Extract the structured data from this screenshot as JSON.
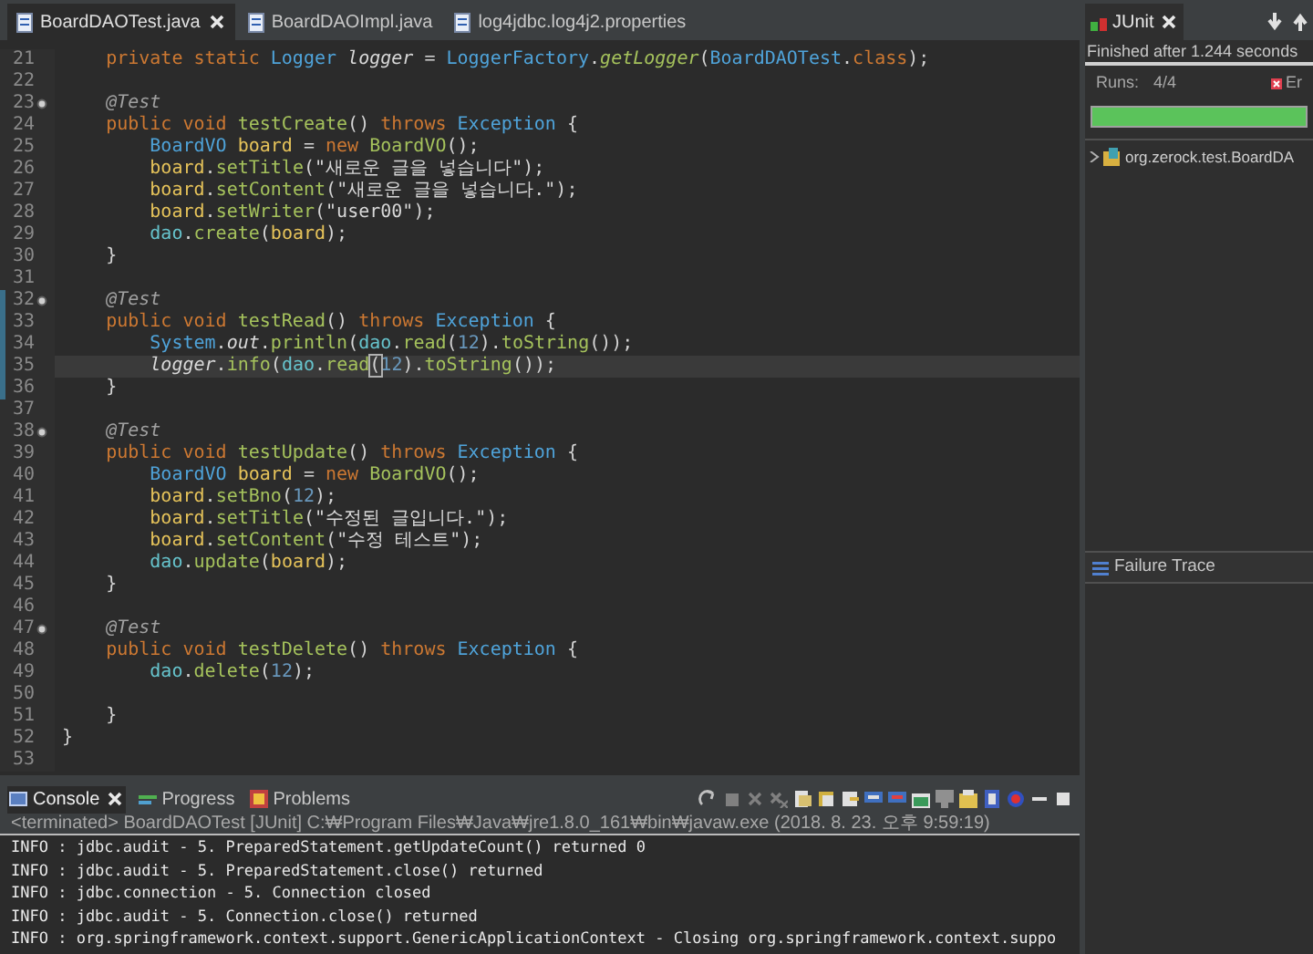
{
  "editor": {
    "tabs": [
      {
        "label": "BoardDAOTest.java",
        "selected": true,
        "closable": true
      },
      {
        "label": "BoardDAOImpl.java",
        "selected": false,
        "closable": false
      },
      {
        "label": "log4jdbc.log4j2.properties",
        "selected": false,
        "closable": false
      }
    ],
    "lines": [
      {
        "number": "21",
        "fold": false,
        "changed": false,
        "current": false,
        "tokens": [
          {
            "kind": "keyword",
            "text": "    private static "
          },
          {
            "kind": "type",
            "text": "Logger "
          },
          {
            "kind": "static",
            "text": "logger"
          },
          {
            "kind": "plain",
            "text": " = "
          },
          {
            "kind": "type",
            "text": "LoggerFactory"
          },
          {
            "kind": "plain",
            "text": "."
          },
          {
            "kind": "static-method",
            "text": "getLogger"
          },
          {
            "kind": "plain",
            "text": "("
          },
          {
            "kind": "type",
            "text": "BoardDAOTest"
          },
          {
            "kind": "plain",
            "text": "."
          },
          {
            "kind": "keyword",
            "text": "class"
          },
          {
            "kind": "plain",
            "text": ");"
          }
        ]
      },
      {
        "number": "22",
        "fold": false,
        "changed": false,
        "current": false
      },
      {
        "number": "23",
        "fold": true,
        "changed": false,
        "current": false,
        "tokens": [
          {
            "kind": "annotation",
            "text": "    @Test"
          }
        ]
      },
      {
        "number": "24",
        "fold": false,
        "changed": false,
        "current": false,
        "tokens": [
          {
            "kind": "keyword",
            "text": "    public void "
          },
          {
            "kind": "method",
            "text": "testCreate"
          },
          {
            "kind": "plain",
            "text": "() "
          },
          {
            "kind": "keyword",
            "text": "throws "
          },
          {
            "kind": "type",
            "text": "Exception"
          },
          {
            "kind": "plain",
            "text": " {"
          }
        ]
      },
      {
        "number": "25",
        "fold": false,
        "changed": false,
        "current": false,
        "tokens": [
          {
            "kind": "type",
            "text": "        BoardVO "
          },
          {
            "kind": "local",
            "text": "board"
          },
          {
            "kind": "plain",
            "text": " = "
          },
          {
            "kind": "keyword",
            "text": "new "
          },
          {
            "kind": "method",
            "text": "BoardVO"
          },
          {
            "kind": "plain",
            "text": "();"
          }
        ]
      },
      {
        "number": "26",
        "fold": false,
        "changed": false,
        "current": false,
        "tokens": [
          {
            "kind": "local",
            "text": "        board"
          },
          {
            "kind": "plain",
            "text": "."
          },
          {
            "kind": "method",
            "text": "setTitle"
          },
          {
            "kind": "plain",
            "text": "("
          },
          {
            "kind": "string",
            "text": "\"새로운 글을 넣습니다\""
          },
          {
            "kind": "plain",
            "text": ");"
          }
        ]
      },
      {
        "number": "27",
        "fold": false,
        "changed": false,
        "current": false,
        "tokens": [
          {
            "kind": "local",
            "text": "        board"
          },
          {
            "kind": "plain",
            "text": "."
          },
          {
            "kind": "method",
            "text": "setContent"
          },
          {
            "kind": "plain",
            "text": "("
          },
          {
            "kind": "string",
            "text": "\"새로운 글을 넣습니다.\""
          },
          {
            "kind": "plain",
            "text": ");"
          }
        ]
      },
      {
        "number": "28",
        "fold": false,
        "changed": false,
        "current": false,
        "tokens": [
          {
            "kind": "local",
            "text": "        board"
          },
          {
            "kind": "plain",
            "text": "."
          },
          {
            "kind": "method",
            "text": "setWriter"
          },
          {
            "kind": "plain",
            "text": "("
          },
          {
            "kind": "string",
            "text": "\"user00\""
          },
          {
            "kind": "plain",
            "text": ");"
          }
        ]
      },
      {
        "number": "29",
        "fold": false,
        "changed": false,
        "current": false,
        "tokens": [
          {
            "kind": "field",
            "text": "        dao"
          },
          {
            "kind": "plain",
            "text": "."
          },
          {
            "kind": "method",
            "text": "create"
          },
          {
            "kind": "plain",
            "text": "("
          },
          {
            "kind": "local",
            "text": "board"
          },
          {
            "kind": "plain",
            "text": ");"
          }
        ]
      },
      {
        "number": "30",
        "fold": false,
        "changed": false,
        "current": false,
        "tokens": [
          {
            "kind": "plain",
            "text": "    }"
          }
        ]
      },
      {
        "number": "31",
        "fold": false,
        "changed": false,
        "current": false
      },
      {
        "number": "32",
        "fold": true,
        "changed": true,
        "current": false,
        "tokens": [
          {
            "kind": "annotation",
            "text": "    @Test"
          }
        ]
      },
      {
        "number": "33",
        "fold": false,
        "changed": true,
        "current": false,
        "tokens": [
          {
            "kind": "keyword",
            "text": "    public void "
          },
          {
            "kind": "method",
            "text": "testRead"
          },
          {
            "kind": "plain",
            "text": "() "
          },
          {
            "kind": "keyword",
            "text": "throws "
          },
          {
            "kind": "type",
            "text": "Exception"
          },
          {
            "kind": "plain",
            "text": " {"
          }
        ]
      },
      {
        "number": "34",
        "fold": false,
        "changed": true,
        "current": false,
        "tokens": [
          {
            "kind": "type",
            "text": "        System"
          },
          {
            "kind": "plain",
            "text": "."
          },
          {
            "kind": "static",
            "text": "out"
          },
          {
            "kind": "plain",
            "text": "."
          },
          {
            "kind": "method",
            "text": "println"
          },
          {
            "kind": "plain",
            "text": "("
          },
          {
            "kind": "field",
            "text": "dao"
          },
          {
            "kind": "plain",
            "text": "."
          },
          {
            "kind": "method",
            "text": "read"
          },
          {
            "kind": "plain",
            "text": "("
          },
          {
            "kind": "number",
            "text": "12"
          },
          {
            "kind": "plain",
            "text": ")."
          },
          {
            "kind": "method",
            "text": "toString"
          },
          {
            "kind": "plain",
            "text": "());"
          }
        ]
      },
      {
        "number": "35",
        "fold": false,
        "changed": true,
        "current": true,
        "tokens": [
          {
            "kind": "static",
            "text": "        logger"
          },
          {
            "kind": "plain",
            "text": "."
          },
          {
            "kind": "method",
            "text": "info"
          },
          {
            "kind": "plain",
            "text": "("
          },
          {
            "kind": "field",
            "text": "dao"
          },
          {
            "kind": "plain",
            "text": "."
          },
          {
            "kind": "method",
            "text": "read"
          },
          {
            "kind": "matched",
            "text": "("
          },
          {
            "kind": "number",
            "text": "12"
          },
          {
            "kind": "plain",
            "text": ")."
          },
          {
            "kind": "method",
            "text": "toString"
          },
          {
            "kind": "plain",
            "text": "());"
          }
        ]
      },
      {
        "number": "36",
        "fold": false,
        "changed": true,
        "current": false,
        "tokens": [
          {
            "kind": "plain",
            "text": "    }"
          }
        ]
      },
      {
        "number": "37",
        "fold": false,
        "changed": false,
        "current": false
      },
      {
        "number": "38",
        "fold": true,
        "changed": false,
        "current": false,
        "tokens": [
          {
            "kind": "annotation",
            "text": "    @Test"
          }
        ]
      },
      {
        "number": "39",
        "fold": false,
        "changed": false,
        "current": false,
        "tokens": [
          {
            "kind": "keyword",
            "text": "    public void "
          },
          {
            "kind": "method",
            "text": "testUpdate"
          },
          {
            "kind": "plain",
            "text": "() "
          },
          {
            "kind": "keyword",
            "text": "throws "
          },
          {
            "kind": "type",
            "text": "Exception"
          },
          {
            "kind": "plain",
            "text": " {"
          }
        ]
      },
      {
        "number": "40",
        "fold": false,
        "changed": false,
        "current": false,
        "tokens": [
          {
            "kind": "type",
            "text": "        BoardVO "
          },
          {
            "kind": "local",
            "text": "board"
          },
          {
            "kind": "plain",
            "text": " = "
          },
          {
            "kind": "keyword",
            "text": "new "
          },
          {
            "kind": "method",
            "text": "BoardVO"
          },
          {
            "kind": "plain",
            "text": "();"
          }
        ]
      },
      {
        "number": "41",
        "fold": false,
        "changed": false,
        "current": false,
        "tokens": [
          {
            "kind": "local",
            "text": "        board"
          },
          {
            "kind": "plain",
            "text": "."
          },
          {
            "kind": "method",
            "text": "setBno"
          },
          {
            "kind": "plain",
            "text": "("
          },
          {
            "kind": "number",
            "text": "12"
          },
          {
            "kind": "plain",
            "text": ");"
          }
        ]
      },
      {
        "number": "42",
        "fold": false,
        "changed": false,
        "current": false,
        "tokens": [
          {
            "kind": "local",
            "text": "        board"
          },
          {
            "kind": "plain",
            "text": "."
          },
          {
            "kind": "method",
            "text": "setTitle"
          },
          {
            "kind": "plain",
            "text": "("
          },
          {
            "kind": "string",
            "text": "\"수정된 글입니다.\""
          },
          {
            "kind": "plain",
            "text": ");"
          }
        ]
      },
      {
        "number": "43",
        "fold": false,
        "changed": false,
        "current": false,
        "tokens": [
          {
            "kind": "local",
            "text": "        board"
          },
          {
            "kind": "plain",
            "text": "."
          },
          {
            "kind": "method",
            "text": "setContent"
          },
          {
            "kind": "plain",
            "text": "("
          },
          {
            "kind": "string",
            "text": "\"수정 테스트\""
          },
          {
            "kind": "plain",
            "text": ");"
          }
        ]
      },
      {
        "number": "44",
        "fold": false,
        "changed": false,
        "current": false,
        "tokens": [
          {
            "kind": "field",
            "text": "        dao"
          },
          {
            "kind": "plain",
            "text": "."
          },
          {
            "kind": "method",
            "text": "update"
          },
          {
            "kind": "plain",
            "text": "("
          },
          {
            "kind": "local",
            "text": "board"
          },
          {
            "kind": "plain",
            "text": ");"
          }
        ]
      },
      {
        "number": "45",
        "fold": false,
        "changed": false,
        "current": false,
        "tokens": [
          {
            "kind": "plain",
            "text": "    }"
          }
        ]
      },
      {
        "number": "46",
        "fold": false,
        "changed": false,
        "current": false
      },
      {
        "number": "47",
        "fold": true,
        "changed": false,
        "current": false,
        "tokens": [
          {
            "kind": "annotation",
            "text": "    @Test"
          }
        ]
      },
      {
        "number": "48",
        "fold": false,
        "changed": false,
        "current": false,
        "tokens": [
          {
            "kind": "keyword",
            "text": "    public void "
          },
          {
            "kind": "method",
            "text": "testDelete"
          },
          {
            "kind": "plain",
            "text": "() "
          },
          {
            "kind": "keyword",
            "text": "throws "
          },
          {
            "kind": "type",
            "text": "Exception"
          },
          {
            "kind": "plain",
            "text": " {"
          }
        ]
      },
      {
        "number": "49",
        "fold": false,
        "changed": false,
        "current": false,
        "tokens": [
          {
            "kind": "field",
            "text": "        dao"
          },
          {
            "kind": "plain",
            "text": "."
          },
          {
            "kind": "method",
            "text": "delete"
          },
          {
            "kind": "plain",
            "text": "("
          },
          {
            "kind": "number",
            "text": "12"
          },
          {
            "kind": "plain",
            "text": ");"
          }
        ]
      },
      {
        "number": "50",
        "fold": false,
        "changed": false,
        "current": false
      },
      {
        "number": "51",
        "fold": false,
        "changed": false,
        "current": false,
        "tokens": [
          {
            "kind": "plain",
            "text": "    }"
          }
        ]
      },
      {
        "number": "52",
        "fold": false,
        "changed": false,
        "current": false,
        "tokens": [
          {
            "kind": "plain",
            "text": "}"
          }
        ]
      },
      {
        "number": "53",
        "fold": false,
        "changed": false,
        "current": false
      }
    ]
  },
  "junit": {
    "tab": {
      "label": "JUnit",
      "selected": true
    },
    "status": "Finished after 1.244 seconds",
    "runs_label": "Runs:",
    "runs": "4/4",
    "errors_label": "Er",
    "level": 1,
    "tree": [
      {
        "label": "org.zerock.test.BoardDA",
        "expanded": false
      }
    ],
    "failure_trace": "Failure Trace"
  },
  "console": {
    "tabs": [
      {
        "label": "Console",
        "selected": true,
        "closable": true
      },
      {
        "label": "Progress",
        "selected": false,
        "closable": false
      },
      {
        "label": "Problems",
        "selected": false,
        "closable": false
      }
    ],
    "terminated": "<terminated> BoardDAOTest [JUnit] C:₩Program Files₩Java₩jre1.8.0_161₩bin₩javaw.exe (2018. 8. 23. 오후 9:59:19)",
    "output": [
      "INFO : jdbc.audit - 5. PreparedStatement.getUpdateCount() returned 0",
      "INFO : jdbc.audit - 5. PreparedStatement.close() returned",
      "INFO : jdbc.connection - 5. Connection closed",
      "INFO : jdbc.audit - 5. Connection.close() returned",
      "INFO : org.springframework.context.support.GenericApplicationContext - Closing org.springframework.context.suppo"
    ]
  }
}
